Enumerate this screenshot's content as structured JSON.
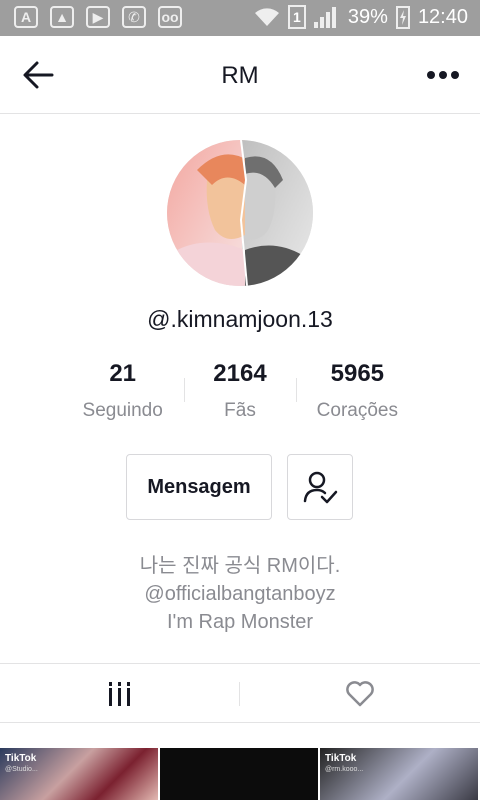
{
  "status_bar": {
    "battery": "39%",
    "time": "12:40",
    "sim": "1"
  },
  "header": {
    "title": "RM"
  },
  "profile": {
    "handle": "@.kimnamjoon.13",
    "stats": [
      {
        "value": "21",
        "label": "Seguindo"
      },
      {
        "value": "2164",
        "label": "Fãs"
      },
      {
        "value": "5965",
        "label": "Corações"
      }
    ],
    "message_button": "Mensagem",
    "bio_lines": [
      "나는 진짜 공식 RM이다.",
      "@officialbangtanboyz",
      "I'm Rap Monster"
    ]
  },
  "tabs": [
    {
      "icon": "videos-grid-icon"
    },
    {
      "icon": "heart-icon"
    }
  ],
  "thumbnails": [
    {
      "watermark": "TikTok",
      "user": "@Studio..."
    },
    {
      "watermark": "",
      "user": ""
    },
    {
      "watermark": "TikTok",
      "user": "@rm.kooo..."
    }
  ]
}
